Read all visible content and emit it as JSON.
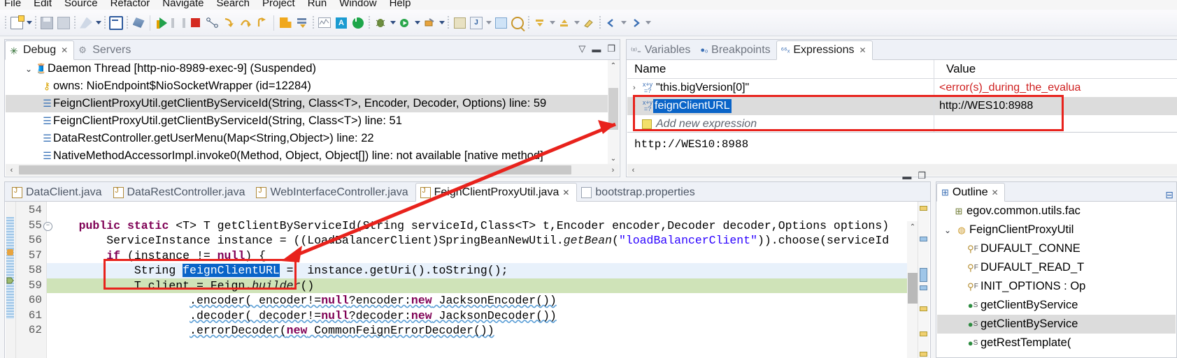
{
  "menu": {
    "items": [
      "File",
      "Edit",
      "Source",
      "Refactor",
      "Navigate",
      "Search",
      "Project",
      "Run",
      "Window",
      "Help"
    ]
  },
  "toolbar": {
    "icons": [
      "new-wizard-icon",
      "new-dropdown-icon",
      "save-icon",
      "save-all-icon",
      "launch-icon",
      "launch-dropdown-icon",
      "console-icon",
      "skip-breakpoints-icon",
      "resume-icon",
      "suspend-icon",
      "terminate-icon",
      "disconnect-icon",
      "step-into-icon",
      "step-over-icon",
      "step-return-icon",
      "use-step-filters-icon",
      "drop-to-frame-icon",
      "monitor-icon",
      "annotation-icon",
      "power-icon",
      "debug-icon",
      "run-icon",
      "external-tools-icon",
      "new-java-project-icon",
      "new-class-icon",
      "open-type-icon",
      "search-icon",
      "next-annotation-icon",
      "previous-annotation-icon",
      "last-edit-icon",
      "back-icon",
      "forward-icon"
    ]
  },
  "debug_view": {
    "tabs": [
      {
        "label": "Debug",
        "icon": "bug-icon",
        "active": true,
        "closable": true
      },
      {
        "label": "Servers",
        "icon": "servers-icon",
        "active": false,
        "closable": false
      }
    ],
    "tree": [
      {
        "indent": 1,
        "chevron": "v",
        "icon": "thread-icon",
        "label": "Daemon Thread [http-nio-8989-exec-9] (Suspended)",
        "selected": false
      },
      {
        "indent": 2,
        "chevron": "",
        "icon": "key-icon",
        "label": "owns: NioEndpoint$NioSocketWrapper  (id=12284)",
        "selected": false
      },
      {
        "indent": 2,
        "chevron": "",
        "icon": "stack-frame-icon",
        "label": "FeignClientProxyUtil.getClientByServiceId(String, Class<T>, Encoder, Decoder, Options) line: 59",
        "selected": true
      },
      {
        "indent": 2,
        "chevron": "",
        "icon": "stack-frame-icon",
        "label": "FeignClientProxyUtil.getClientByServiceId(String, Class<T>) line: 51",
        "selected": false
      },
      {
        "indent": 2,
        "chevron": "",
        "icon": "stack-frame-icon",
        "label": "DataRestController.getUserMenu(Map<String,Object>) line: 22",
        "selected": false
      },
      {
        "indent": 2,
        "chevron": "",
        "icon": "stack-frame-icon",
        "label": "NativeMethodAccessorImpl.invoke0(Method, Object, Object[]) line: not available [native method]",
        "selected": false
      }
    ]
  },
  "expressions_view": {
    "tabs": [
      {
        "label": "Variables",
        "icon": "variables-icon",
        "active": false,
        "closable": false
      },
      {
        "label": "Breakpoints",
        "icon": "breakpoints-icon",
        "active": false,
        "closable": false
      },
      {
        "label": "Expressions",
        "icon": "expressions-icon",
        "active": true,
        "closable": true
      }
    ],
    "columns": {
      "name": "Name",
      "value": "Value"
    },
    "rows": [
      {
        "name": "\"this.bigVersion[0]\"",
        "value": "<error(s)_during_the_evalua",
        "value_error": true,
        "selected": false,
        "editing": false
      },
      {
        "name": "feignClientURL",
        "value": "http://WES10:8988",
        "value_error": false,
        "selected": true,
        "editing": true
      },
      {
        "name": "Add new expression",
        "value": "",
        "value_error": false,
        "selected": false,
        "editing": false
      }
    ],
    "detail": "http://WES10:8988"
  },
  "editor": {
    "tabs": [
      {
        "label": "DataClient.java",
        "icon": "java-file-icon",
        "active": false
      },
      {
        "label": "DataRestController.java",
        "icon": "java-file-icon",
        "active": false
      },
      {
        "label": "WebInterfaceController.java",
        "icon": "java-file-icon",
        "active": false
      },
      {
        "label": "FeignClientProxyUtil.java",
        "icon": "java-file-icon",
        "active": true,
        "closable": true
      },
      {
        "label": "bootstrap.properties",
        "icon": "properties-file-icon",
        "active": false
      }
    ],
    "lines": [
      {
        "num": "54",
        "fold": false,
        "highlight": "none",
        "text": ""
      },
      {
        "num": "55",
        "fold": true,
        "highlight": "none",
        "text": "    public static <T> T getClientByServiceId(String serviceId,Class<T> t,Encoder encoder,Decoder decoder,Options options)"
      },
      {
        "num": "56",
        "fold": false,
        "highlight": "none",
        "text": "        ServiceInstance instance = ((LoadBalancerClient)SpringBeanNewUtil.getBean(\"loadBalancerClient\")).choose(serviceId"
      },
      {
        "num": "57",
        "fold": false,
        "highlight": "none",
        "text": "        if (instance != null) {"
      },
      {
        "num": "58",
        "fold": false,
        "highlight": "blue",
        "text": "            String feignClientURL =  instance.getUri().toString();"
      },
      {
        "num": "59",
        "fold": false,
        "highlight": "green",
        "text": "            T client = Feign.builder()"
      },
      {
        "num": "60",
        "fold": false,
        "highlight": "none",
        "text": "                    .encoder( encoder!=null?encoder:new JacksonEncoder())"
      },
      {
        "num": "61",
        "fold": false,
        "highlight": "none",
        "text": "                    .decoder( decoder!=null?decoder:new JacksonDecoder())"
      },
      {
        "num": "62",
        "fold": false,
        "highlight": "none",
        "text": "                    .errorDecoder(new CommonFeignErrorDecoder())"
      }
    ],
    "selected_token": "feignClientURL"
  },
  "outline_view": {
    "tab": {
      "label": "Outline",
      "icon": "outline-icon",
      "closable": true
    },
    "rows": [
      {
        "indent": 1,
        "chevron": "",
        "icon": "package-icon",
        "label": "egov.common.utils.fac",
        "selected": false
      },
      {
        "indent": 0,
        "chevron": "v",
        "icon": "class-icon",
        "label": "FeignClientProxyUtil ",
        "selected": false
      },
      {
        "indent": 2,
        "chevron": "",
        "icon": "static-field-icon",
        "label": "DUFAULT_CONNE",
        "selected": false
      },
      {
        "indent": 2,
        "chevron": "",
        "icon": "static-field-icon",
        "label": "DUFAULT_READ_T",
        "selected": false
      },
      {
        "indent": 2,
        "chevron": "",
        "icon": "static-field-icon",
        "label": "INIT_OPTIONS : Op",
        "selected": false
      },
      {
        "indent": 2,
        "chevron": "",
        "icon": "static-method-icon",
        "label": "getClientByService",
        "selected": false
      },
      {
        "indent": 2,
        "chevron": "",
        "icon": "static-method-icon",
        "label": "getClientByService",
        "selected": true
      },
      {
        "indent": 2,
        "chevron": "",
        "icon": "static-method-icon",
        "label": "getRestTemplate(",
        "selected": false
      }
    ]
  },
  "annotations": {
    "color": "#e8221c",
    "boxes": [
      {
        "name": "expression-row-highlight"
      },
      {
        "name": "code-variable-highlight"
      }
    ],
    "arrow": {
      "name": "pointer-arrow",
      "from": "expression-row",
      "to": "code-variable"
    }
  },
  "colors": {
    "accent": "#0a64c8",
    "annotation_red": "#e8221c",
    "error_red": "#cf1f1f",
    "keyword_purple": "#7f0055",
    "string_blue": "#2a00ff",
    "current_line_green": "#cfe3b8",
    "selection_grey": "#dcdcdc"
  }
}
